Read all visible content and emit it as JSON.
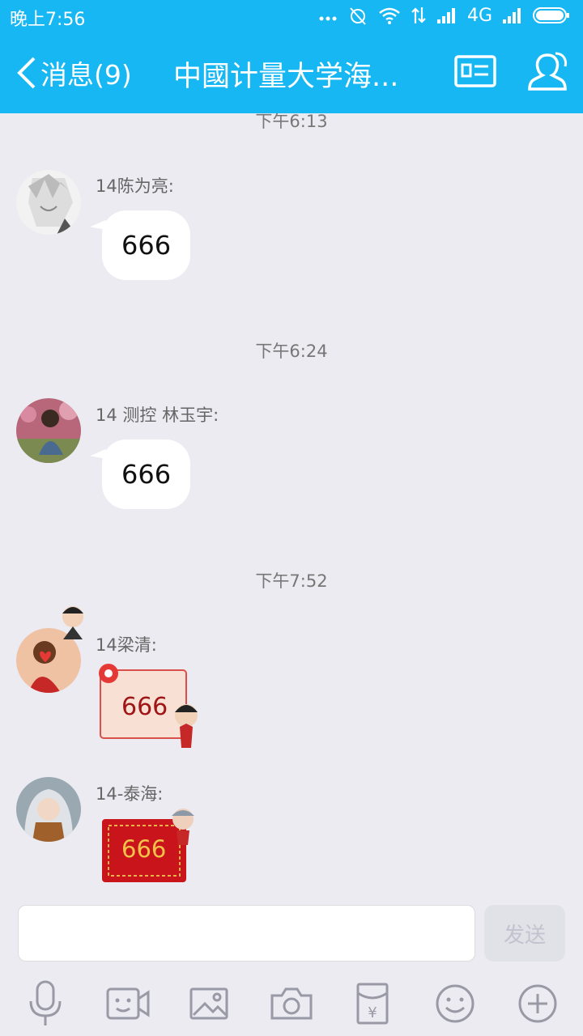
{
  "status_bar": {
    "time": "晚上7:56",
    "network": "4G"
  },
  "header": {
    "back_label": "消息(9)",
    "title": "中國计量大学海...",
    "icons": [
      "profile-card-icon",
      "group-members-icon"
    ]
  },
  "messages": [
    {
      "timestamp": "下午6:13",
      "sender": "14陈为亮:",
      "text": "666",
      "type": "text"
    },
    {
      "timestamp": "下午6:24",
      "sender": "14  测控  林玉宇:",
      "text": "666",
      "type": "text"
    },
    {
      "timestamp": "下午7:52",
      "sender": "14梁清:",
      "text": "666",
      "type": "sticker"
    },
    {
      "sender": "14-泰海:",
      "text": "666",
      "type": "sticker"
    }
  ],
  "composer": {
    "input_value": "",
    "send_label": "发送"
  },
  "toolbar": [
    "mic-icon",
    "video-icon",
    "image-icon",
    "camera-icon",
    "red-packet-icon",
    "emoji-icon",
    "plus-icon"
  ],
  "colors": {
    "header": "#16b7f2",
    "background": "#ebebf1",
    "sticker_red": "#c9141c"
  }
}
